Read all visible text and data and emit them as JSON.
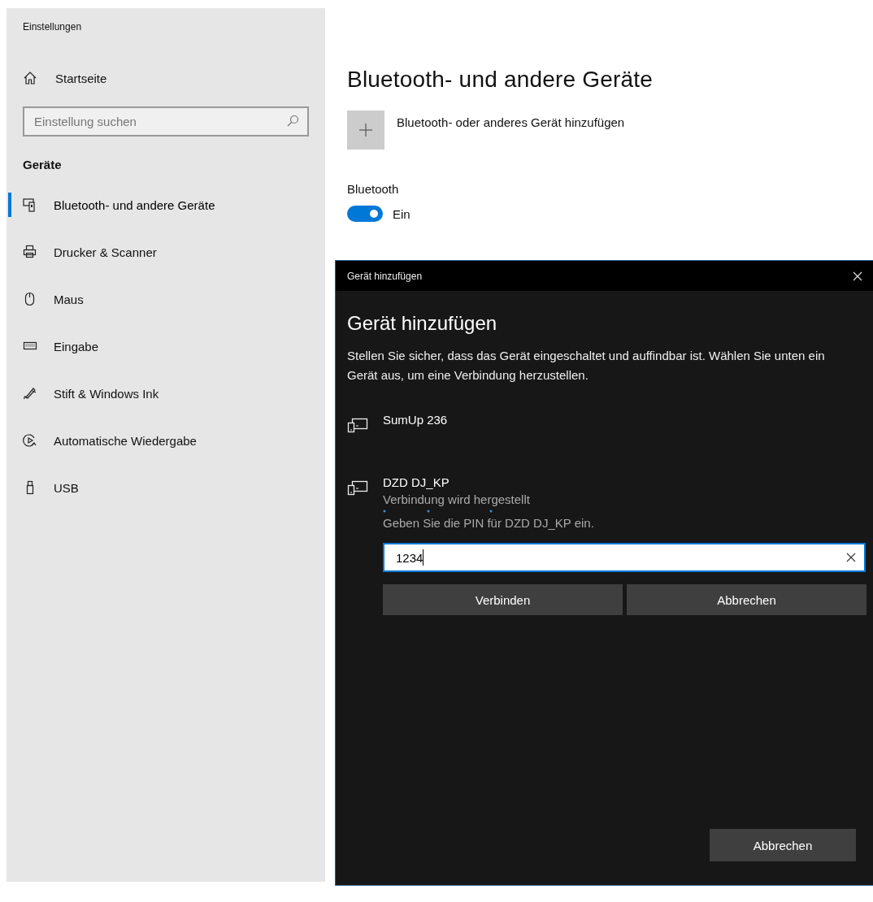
{
  "window": {
    "title": "Einstellungen"
  },
  "sidebar": {
    "home": {
      "label": "Startseite"
    },
    "search": {
      "placeholder": "Einstellung suchen"
    },
    "section": "Geräte",
    "items": [
      {
        "label": "Bluetooth- und andere Geräte",
        "selected": true
      },
      {
        "label": "Drucker & Scanner",
        "selected": false
      },
      {
        "label": "Maus",
        "selected": false
      },
      {
        "label": "Eingabe",
        "selected": false
      },
      {
        "label": "Stift & Windows Ink",
        "selected": false
      },
      {
        "label": "Automatische Wiedergabe",
        "selected": false
      },
      {
        "label": "USB",
        "selected": false
      }
    ]
  },
  "main": {
    "title": "Bluetooth- und andere Geräte",
    "add_device": {
      "label": "Bluetooth- oder anderes Gerät hinzufügen"
    },
    "bluetooth": {
      "label": "Bluetooth",
      "on": true,
      "state_text": "Ein"
    }
  },
  "dialog": {
    "title": "Gerät hinzufügen",
    "heading": "Gerät hinzufügen",
    "description": "Stellen Sie sicher, dass das Gerät eingeschaltet und auffindbar ist. Wählen Sie unten ein Gerät aus, um eine Verbindung herzustellen.",
    "devices": [
      {
        "kind": "plain",
        "name": "SumUp 236"
      },
      {
        "kind": "pairing",
        "name": "DZD DJ_KP",
        "status": "Verbindung wird hergestellt",
        "pin_prompt": "Geben Sie die PIN für DZD DJ_KP ein.",
        "pin_value": "1234",
        "buttons": [
          "Verbinden",
          "Abbrechen"
        ]
      }
    ],
    "footer_button": "Abbrechen"
  }
}
